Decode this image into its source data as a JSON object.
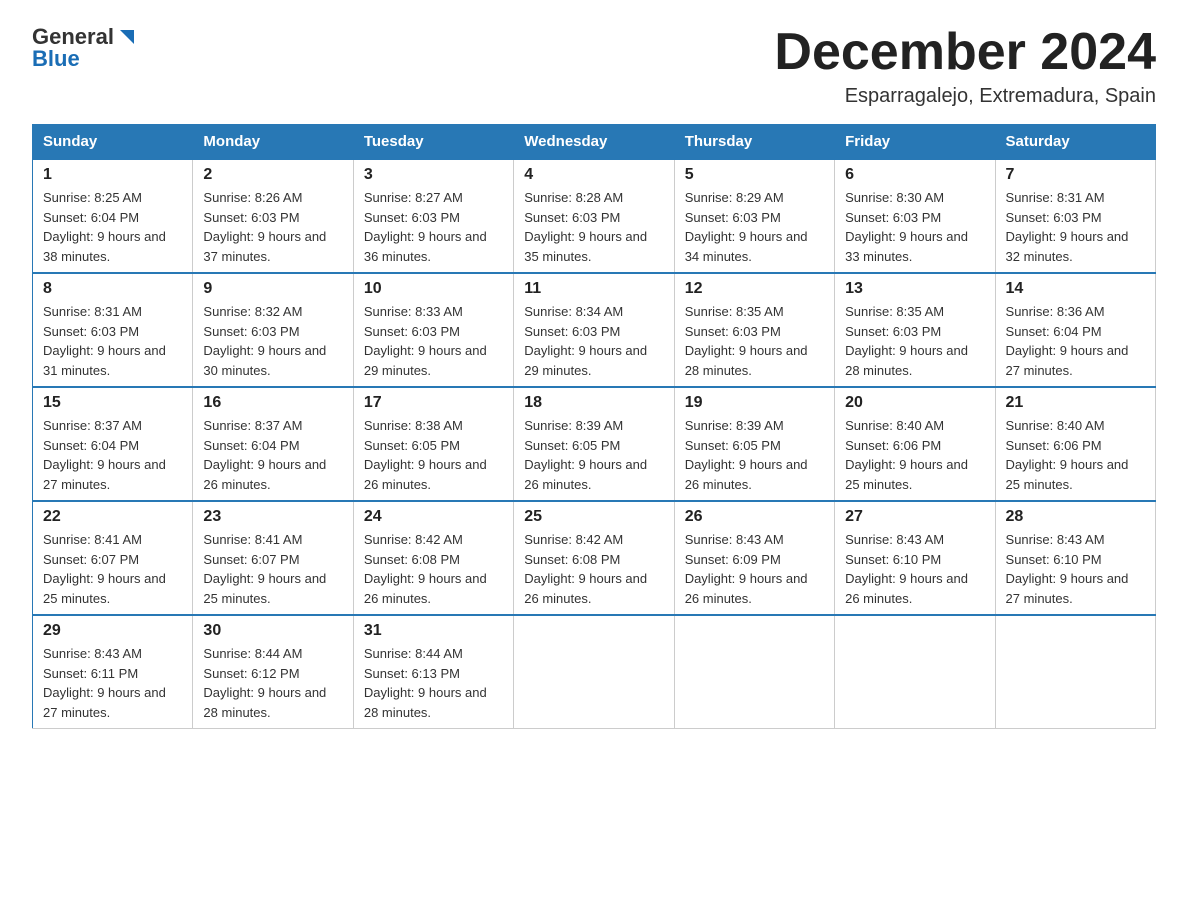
{
  "logo": {
    "name": "General",
    "blue_text": "Blue"
  },
  "title": "December 2024",
  "location": "Esparragalejo, Extremadura, Spain",
  "days_of_week": [
    "Sunday",
    "Monday",
    "Tuesday",
    "Wednesday",
    "Thursday",
    "Friday",
    "Saturday"
  ],
  "weeks": [
    [
      {
        "num": "1",
        "sunrise": "8:25 AM",
        "sunset": "6:04 PM",
        "daylight": "9 hours and 38 minutes."
      },
      {
        "num": "2",
        "sunrise": "8:26 AM",
        "sunset": "6:03 PM",
        "daylight": "9 hours and 37 minutes."
      },
      {
        "num": "3",
        "sunrise": "8:27 AM",
        "sunset": "6:03 PM",
        "daylight": "9 hours and 36 minutes."
      },
      {
        "num": "4",
        "sunrise": "8:28 AM",
        "sunset": "6:03 PM",
        "daylight": "9 hours and 35 minutes."
      },
      {
        "num": "5",
        "sunrise": "8:29 AM",
        "sunset": "6:03 PM",
        "daylight": "9 hours and 34 minutes."
      },
      {
        "num": "6",
        "sunrise": "8:30 AM",
        "sunset": "6:03 PM",
        "daylight": "9 hours and 33 minutes."
      },
      {
        "num": "7",
        "sunrise": "8:31 AM",
        "sunset": "6:03 PM",
        "daylight": "9 hours and 32 minutes."
      }
    ],
    [
      {
        "num": "8",
        "sunrise": "8:31 AM",
        "sunset": "6:03 PM",
        "daylight": "9 hours and 31 minutes."
      },
      {
        "num": "9",
        "sunrise": "8:32 AM",
        "sunset": "6:03 PM",
        "daylight": "9 hours and 30 minutes."
      },
      {
        "num": "10",
        "sunrise": "8:33 AM",
        "sunset": "6:03 PM",
        "daylight": "9 hours and 29 minutes."
      },
      {
        "num": "11",
        "sunrise": "8:34 AM",
        "sunset": "6:03 PM",
        "daylight": "9 hours and 29 minutes."
      },
      {
        "num": "12",
        "sunrise": "8:35 AM",
        "sunset": "6:03 PM",
        "daylight": "9 hours and 28 minutes."
      },
      {
        "num": "13",
        "sunrise": "8:35 AM",
        "sunset": "6:03 PM",
        "daylight": "9 hours and 28 minutes."
      },
      {
        "num": "14",
        "sunrise": "8:36 AM",
        "sunset": "6:04 PM",
        "daylight": "9 hours and 27 minutes."
      }
    ],
    [
      {
        "num": "15",
        "sunrise": "8:37 AM",
        "sunset": "6:04 PM",
        "daylight": "9 hours and 27 minutes."
      },
      {
        "num": "16",
        "sunrise": "8:37 AM",
        "sunset": "6:04 PM",
        "daylight": "9 hours and 26 minutes."
      },
      {
        "num": "17",
        "sunrise": "8:38 AM",
        "sunset": "6:05 PM",
        "daylight": "9 hours and 26 minutes."
      },
      {
        "num": "18",
        "sunrise": "8:39 AM",
        "sunset": "6:05 PM",
        "daylight": "9 hours and 26 minutes."
      },
      {
        "num": "19",
        "sunrise": "8:39 AM",
        "sunset": "6:05 PM",
        "daylight": "9 hours and 26 minutes."
      },
      {
        "num": "20",
        "sunrise": "8:40 AM",
        "sunset": "6:06 PM",
        "daylight": "9 hours and 25 minutes."
      },
      {
        "num": "21",
        "sunrise": "8:40 AM",
        "sunset": "6:06 PM",
        "daylight": "9 hours and 25 minutes."
      }
    ],
    [
      {
        "num": "22",
        "sunrise": "8:41 AM",
        "sunset": "6:07 PM",
        "daylight": "9 hours and 25 minutes."
      },
      {
        "num": "23",
        "sunrise": "8:41 AM",
        "sunset": "6:07 PM",
        "daylight": "9 hours and 25 minutes."
      },
      {
        "num": "24",
        "sunrise": "8:42 AM",
        "sunset": "6:08 PM",
        "daylight": "9 hours and 26 minutes."
      },
      {
        "num": "25",
        "sunrise": "8:42 AM",
        "sunset": "6:08 PM",
        "daylight": "9 hours and 26 minutes."
      },
      {
        "num": "26",
        "sunrise": "8:43 AM",
        "sunset": "6:09 PM",
        "daylight": "9 hours and 26 minutes."
      },
      {
        "num": "27",
        "sunrise": "8:43 AM",
        "sunset": "6:10 PM",
        "daylight": "9 hours and 26 minutes."
      },
      {
        "num": "28",
        "sunrise": "8:43 AM",
        "sunset": "6:10 PM",
        "daylight": "9 hours and 27 minutes."
      }
    ],
    [
      {
        "num": "29",
        "sunrise": "8:43 AM",
        "sunset": "6:11 PM",
        "daylight": "9 hours and 27 minutes."
      },
      {
        "num": "30",
        "sunrise": "8:44 AM",
        "sunset": "6:12 PM",
        "daylight": "9 hours and 28 minutes."
      },
      {
        "num": "31",
        "sunrise": "8:44 AM",
        "sunset": "6:13 PM",
        "daylight": "9 hours and 28 minutes."
      },
      null,
      null,
      null,
      null
    ]
  ]
}
